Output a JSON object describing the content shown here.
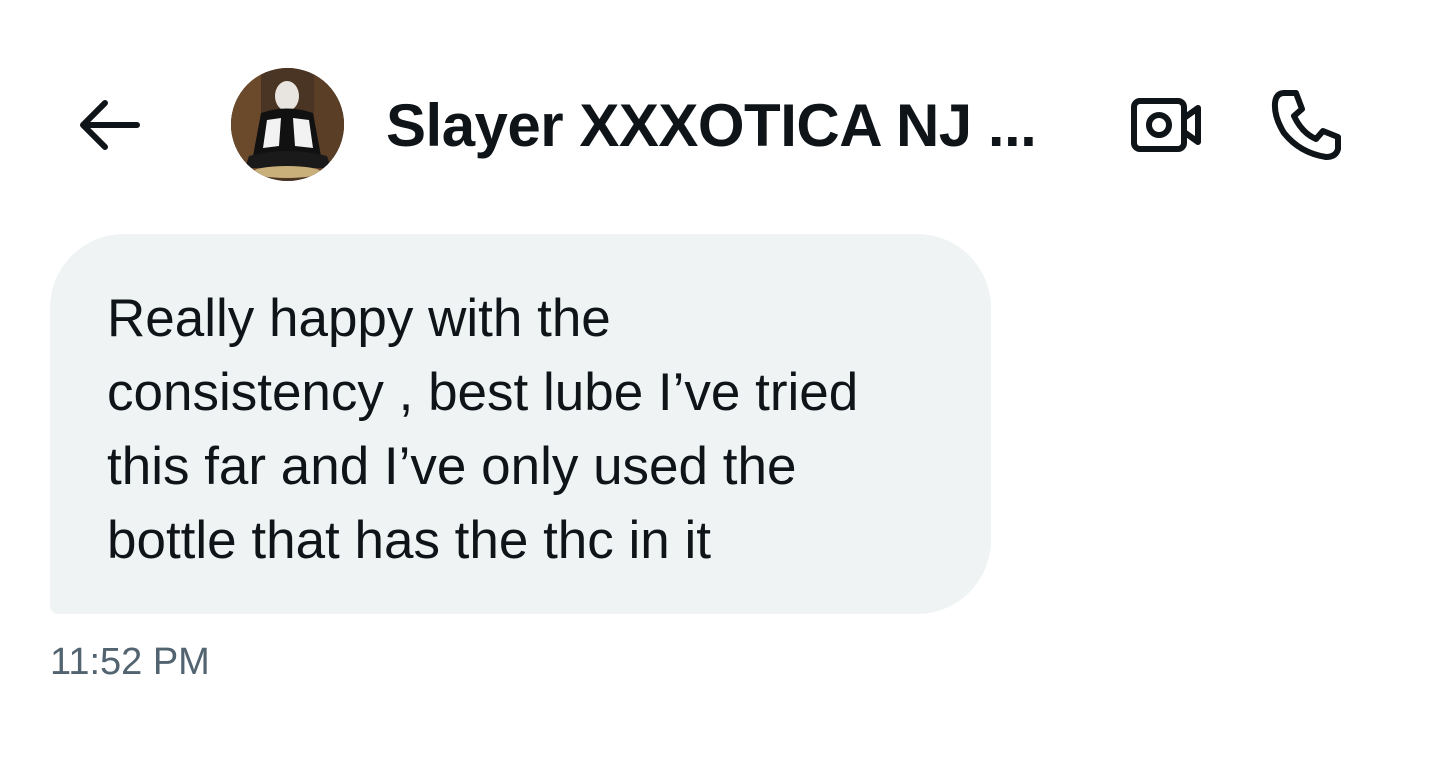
{
  "header": {
    "back_icon": "arrow-left-icon",
    "contact_name": "Slayer XXXOTICA NJ ...",
    "video_icon": "video-camera-icon",
    "call_icon": "phone-icon"
  },
  "message": {
    "text": "Really happy with the\nconsistency , best lube I’ve tried\nthis far and I’ve only used the\nbottle that has the thc in it",
    "time": "11:52 PM"
  },
  "colors": {
    "bubble_bg": "#eff3f4",
    "text": "#0f1419",
    "muted": "#536471"
  }
}
